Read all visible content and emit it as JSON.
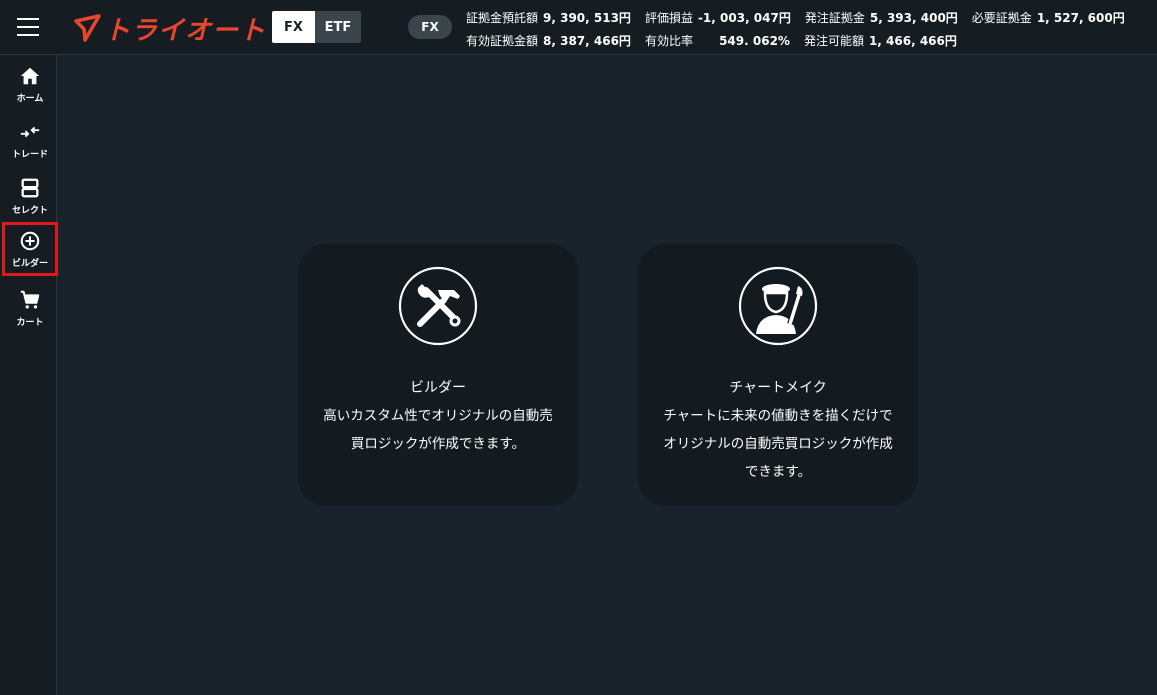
{
  "app": {
    "logo_text": "トライオート",
    "brand_color": "#e8462d"
  },
  "header": {
    "menu_icon": "hamburger-menu-icon",
    "segments": [
      {
        "label": "FX",
        "active": true
      },
      {
        "label": "ETF",
        "active": false
      }
    ],
    "mode_pill": "FX",
    "stats_row1": [
      {
        "label": "証拠金預託額",
        "value": "9, 390, 513円"
      },
      {
        "label": "評価損益",
        "value": "-1, 003, 047円"
      },
      {
        "label": "発注証拠金",
        "value": "5, 393, 400円"
      },
      {
        "label": "必要証拠金",
        "value": "1, 527, 600円"
      }
    ],
    "stats_row2": [
      {
        "label": "有効証拠金額",
        "value": "8, 387, 466円"
      },
      {
        "label": "有効比率",
        "value": "549. 062%"
      },
      {
        "label": "発注可能額",
        "value": "1, 466, 466円"
      }
    ]
  },
  "sidebar": {
    "items": [
      {
        "label": "ホーム",
        "icon": "home-icon"
      },
      {
        "label": "トレード",
        "icon": "trade-arrows-icon"
      },
      {
        "label": "セレクト",
        "icon": "select-icon"
      },
      {
        "label": "ビルダー",
        "icon": "plus-circle-icon",
        "selected": true
      },
      {
        "label": "カート",
        "icon": "cart-icon"
      }
    ],
    "highlight_color": "#e0191f"
  },
  "cards": [
    {
      "icon": "wrench-hammer-icon",
      "title": "ビルダー",
      "desc_lines": [
        "高いカスタム性でオリジナルの自動売",
        "買ロジックが作成できます。"
      ]
    },
    {
      "icon": "artist-icon",
      "title": "チャートメイク",
      "desc_lines": [
        "チャートに未来の値動きを描くだけで",
        "オリジナルの自動売買ロジックが作成",
        "できます。"
      ]
    }
  ]
}
